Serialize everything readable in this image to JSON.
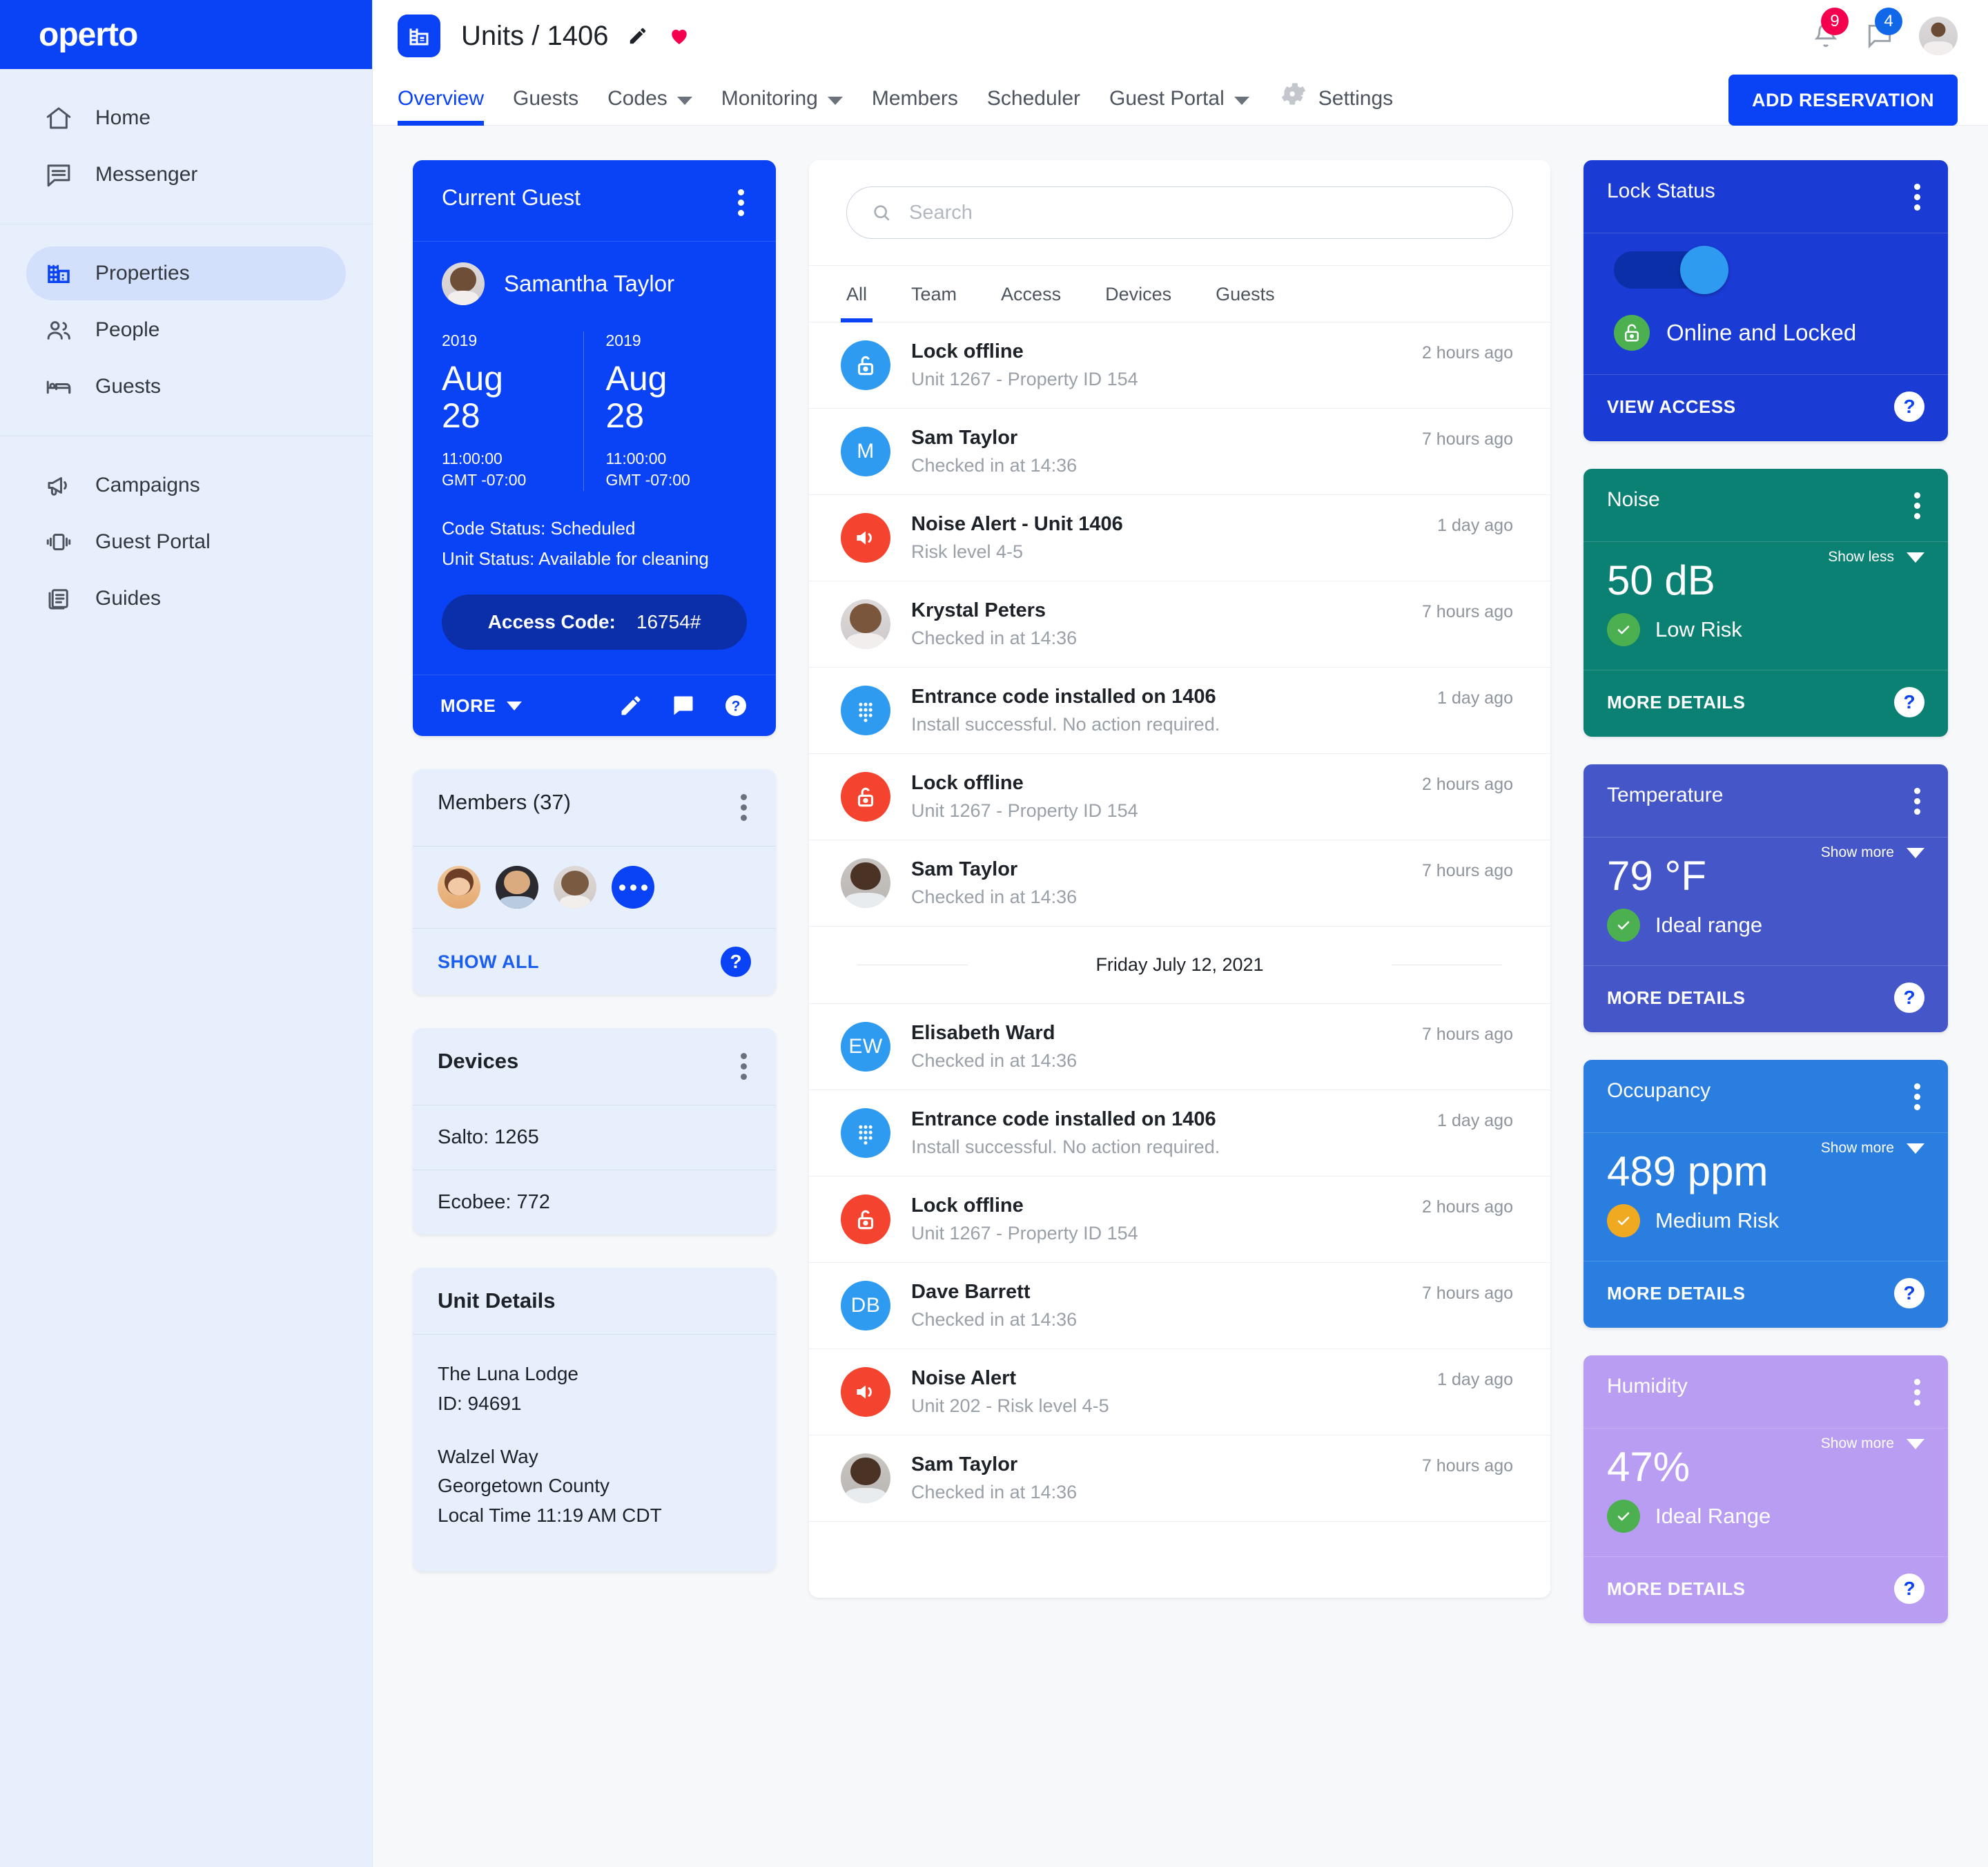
{
  "brand": {
    "name": "operto",
    "primary": "#0a42f5",
    "accent_pink": "#f5004f"
  },
  "sidebar": {
    "groups": [
      {
        "items": [
          {
            "label": "Home",
            "icon": "home-icon",
            "active": false
          },
          {
            "label": "Messenger",
            "icon": "message-icon",
            "active": false
          }
        ]
      },
      {
        "items": [
          {
            "label": "Properties",
            "icon": "building-icon",
            "active": true
          },
          {
            "label": "People",
            "icon": "people-icon",
            "active": false
          },
          {
            "label": "Guests",
            "icon": "bed-icon",
            "active": false
          }
        ]
      },
      {
        "items": [
          {
            "label": "Campaigns",
            "icon": "megaphone-icon",
            "active": false
          },
          {
            "label": "Guest Portal",
            "icon": "mobile-icon",
            "active": false
          },
          {
            "label": "Guides",
            "icon": "book-icon",
            "active": false
          }
        ]
      }
    ]
  },
  "topbar": {
    "page_title": "Units / 1406",
    "notifications_count": "9",
    "messages_count": "4",
    "add_reservation_label": "ADD RESERVATION",
    "tabs": [
      {
        "label": "Overview",
        "active": true,
        "caret": false
      },
      {
        "label": "Guests",
        "active": false,
        "caret": false
      },
      {
        "label": "Codes",
        "active": false,
        "caret": true
      },
      {
        "label": "Monitoring",
        "active": false,
        "caret": true
      },
      {
        "label": "Members",
        "active": false,
        "caret": false
      },
      {
        "label": "Scheduler",
        "active": false,
        "caret": false
      },
      {
        "label": "Guest Portal",
        "active": false,
        "caret": true
      },
      {
        "label": "Settings",
        "active": false,
        "caret": false,
        "gear": true
      }
    ]
  },
  "current_guest": {
    "card_title": "Current Guest",
    "name": "Samantha Taylor",
    "check_in": {
      "year": "2019",
      "month": "Aug",
      "day": "28",
      "time": "11:00:00",
      "tz": "GMT -07:00"
    },
    "check_out": {
      "year": "2019",
      "month": "Aug",
      "day": "28",
      "time": "11:00:00",
      "tz": "GMT -07:00"
    },
    "code_status": "Code Status: Scheduled",
    "unit_status": "Unit Status:  Available for cleaning",
    "access_code_label": "Access Code:",
    "access_code_value": "16754#",
    "more_label": "MORE"
  },
  "members": {
    "title": "Members (37)",
    "show_all_label": "SHOW ALL",
    "avatar_count": 3
  },
  "devices": {
    "title": "Devices",
    "rows": [
      "Salto: 1265",
      "Ecobee: 772"
    ]
  },
  "unit_details": {
    "title": "Unit Details",
    "property_name": "The Luna Lodge",
    "id_line": "ID: 94691",
    "street": "Walzel Way",
    "county": "Georgetown County",
    "local_time": "Local Time 11:19 AM CDT"
  },
  "activity": {
    "search_placeholder": "Search",
    "search_value": "",
    "tabs": [
      {
        "label": "All",
        "active": true
      },
      {
        "label": "Team",
        "active": false
      },
      {
        "label": "Access",
        "active": false
      },
      {
        "label": "Devices",
        "active": false
      },
      {
        "label": "Guests",
        "active": false
      }
    ],
    "rows": [
      {
        "kind": "icon",
        "icon": "lock-open-icon",
        "color": "blue",
        "title": "Lock offline",
        "sub": "Unit 1267  - Property ID 154",
        "time": "2 hours ago"
      },
      {
        "kind": "initials",
        "initials": "M",
        "color": "blue",
        "title": "Sam Taylor",
        "sub": "Checked in at 14:36",
        "time": "7 hours ago"
      },
      {
        "kind": "icon",
        "icon": "volume-icon",
        "color": "red",
        "title": "Noise Alert - Unit 1406",
        "sub": "Risk level 4-5",
        "time": "1 day ago"
      },
      {
        "kind": "photo",
        "photo": "woman",
        "title": "Krystal Peters",
        "sub": "Checked in at 14:36",
        "time": "7 hours ago"
      },
      {
        "kind": "icon",
        "icon": "keypad-icon",
        "color": "blue",
        "title": "Entrance code installed on 1406",
        "sub": "Install successful. No action required.",
        "time": "1 day ago"
      },
      {
        "kind": "icon",
        "icon": "lock-open-icon",
        "color": "red",
        "title": "Lock offline",
        "sub": "Unit 1267  - Property ID 154",
        "time": "2 hours ago"
      },
      {
        "kind": "photo",
        "photo": "man",
        "title": "Sam Taylor",
        "sub": "Checked in at 14:36",
        "time": "7 hours ago"
      },
      {
        "kind": "day-separator",
        "label": "Friday July 12, 2021"
      },
      {
        "kind": "initials",
        "initials": "EW",
        "color": "blue",
        "title": "Elisabeth Ward",
        "sub": "Checked in at 14:36",
        "time": "7 hours ago"
      },
      {
        "kind": "icon",
        "icon": "keypad-icon",
        "color": "blue",
        "title": "Entrance code installed on 1406",
        "sub": "Install successful. No action required.",
        "time": "1 day ago"
      },
      {
        "kind": "icon",
        "icon": "lock-open-icon",
        "color": "red",
        "title": "Lock offline",
        "sub": "Unit 1267  - Property ID 154",
        "time": "2 hours ago"
      },
      {
        "kind": "initials",
        "initials": "DB",
        "color": "blue",
        "title": "Dave Barrett",
        "sub": "Checked in at 14:36",
        "time": "7 hours ago"
      },
      {
        "kind": "icon",
        "icon": "volume-icon",
        "color": "red",
        "title": "Noise Alert",
        "sub": "Unit 202  - Risk level 4-5",
        "time": "1 day ago"
      },
      {
        "kind": "photo",
        "photo": "man",
        "title": "Sam Taylor",
        "sub": "Checked in at 14:36",
        "time": "7 hours ago"
      }
    ]
  },
  "sensors": {
    "lock": {
      "title": "Lock Status",
      "status_text": "Online and Locked",
      "foot_link": "VIEW ACCESS",
      "bg": "#1a3bd4",
      "toggle_on": true
    },
    "cards": [
      {
        "title": "Noise",
        "value": "50 dB",
        "status": "Low Risk",
        "status_color": "green",
        "toggle_label": "Show less",
        "foot_link": "MORE DETAILS",
        "bg": "#0b8174"
      },
      {
        "title": "Temperature",
        "value": "79 °F",
        "status": "Ideal range",
        "status_color": "green",
        "toggle_label": "Show more",
        "foot_link": "MORE DETAILS",
        "bg": "#4456c8"
      },
      {
        "title": "Occupancy",
        "value": "489 ppm",
        "status": "Medium Risk",
        "status_color": "amber",
        "toggle_label": "Show more",
        "foot_link": "MORE DETAILS",
        "bg": "#2a7ee0"
      },
      {
        "title": "Humidity",
        "value": "47%",
        "status": "Ideal Range",
        "status_color": "green",
        "toggle_label": "Show more",
        "foot_link": "MORE DETAILS",
        "bg": "#b89df2"
      }
    ]
  }
}
